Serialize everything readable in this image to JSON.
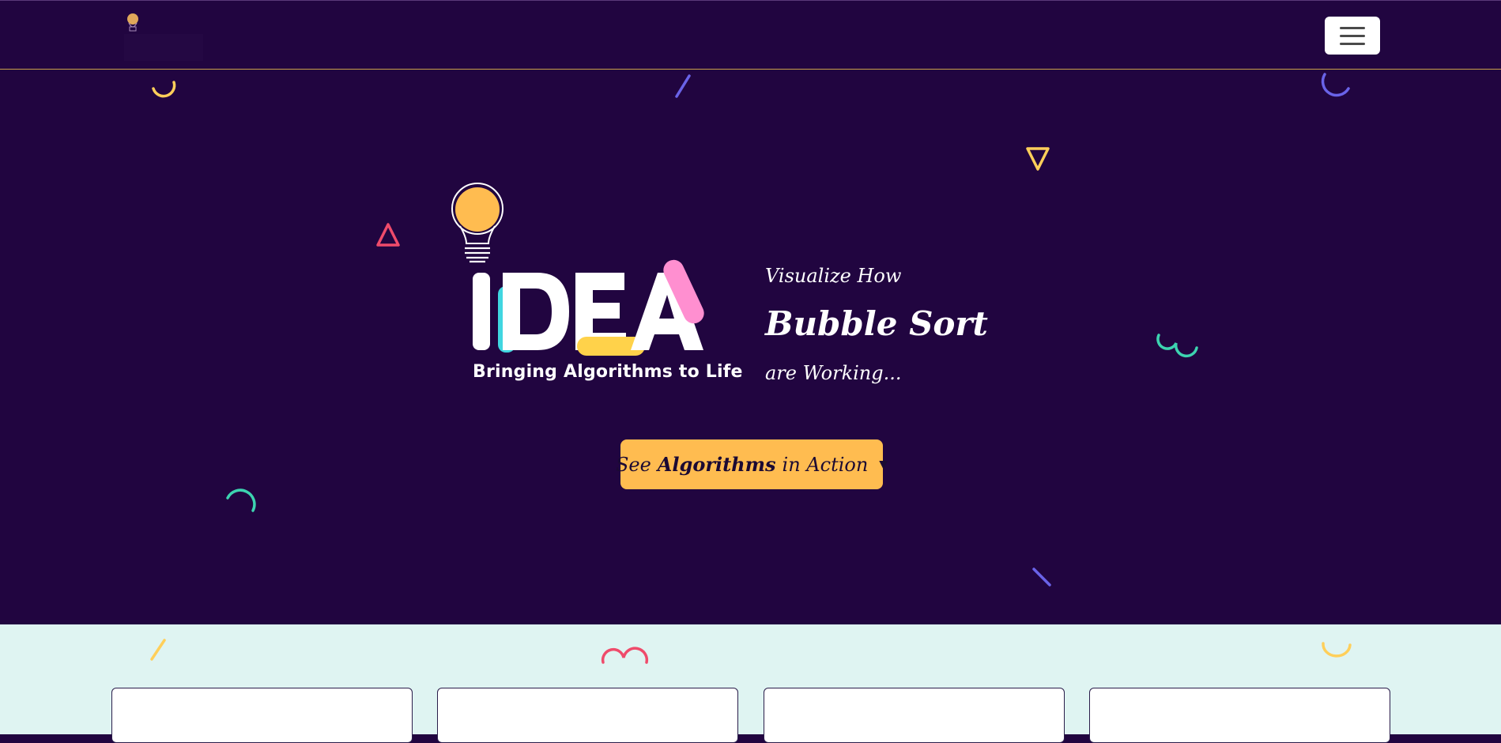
{
  "navbar": {
    "logo_icon": "lightbulb-logo-icon",
    "menu_icon": "hamburger-menu-icon"
  },
  "hero": {
    "logo": {
      "wordmark": "IDEA",
      "tagline": "Bringing Algorithms to Life",
      "icon": "lightbulb-icon"
    },
    "headline": {
      "line1": "Visualize How",
      "line2": "Bubble Sort",
      "line3": "are Working..."
    },
    "cta": {
      "prefix": "See",
      "bold": "Algorithms",
      "suffix": "in Action",
      "caret": "▼"
    }
  },
  "colors": {
    "background": "#210540",
    "accent_yellow": "#ffbc50",
    "accent_pink": "#ff8fd0",
    "accent_cyan": "#40d6e0",
    "accent_teal": "#3dd3b0",
    "accent_red": "#ef4b6b",
    "accent_purple": "#6a63e8",
    "section_bg": "#dff4f2"
  },
  "cards": [
    {
      "id": "card-1"
    },
    {
      "id": "card-2"
    },
    {
      "id": "card-3"
    },
    {
      "id": "card-4"
    }
  ]
}
